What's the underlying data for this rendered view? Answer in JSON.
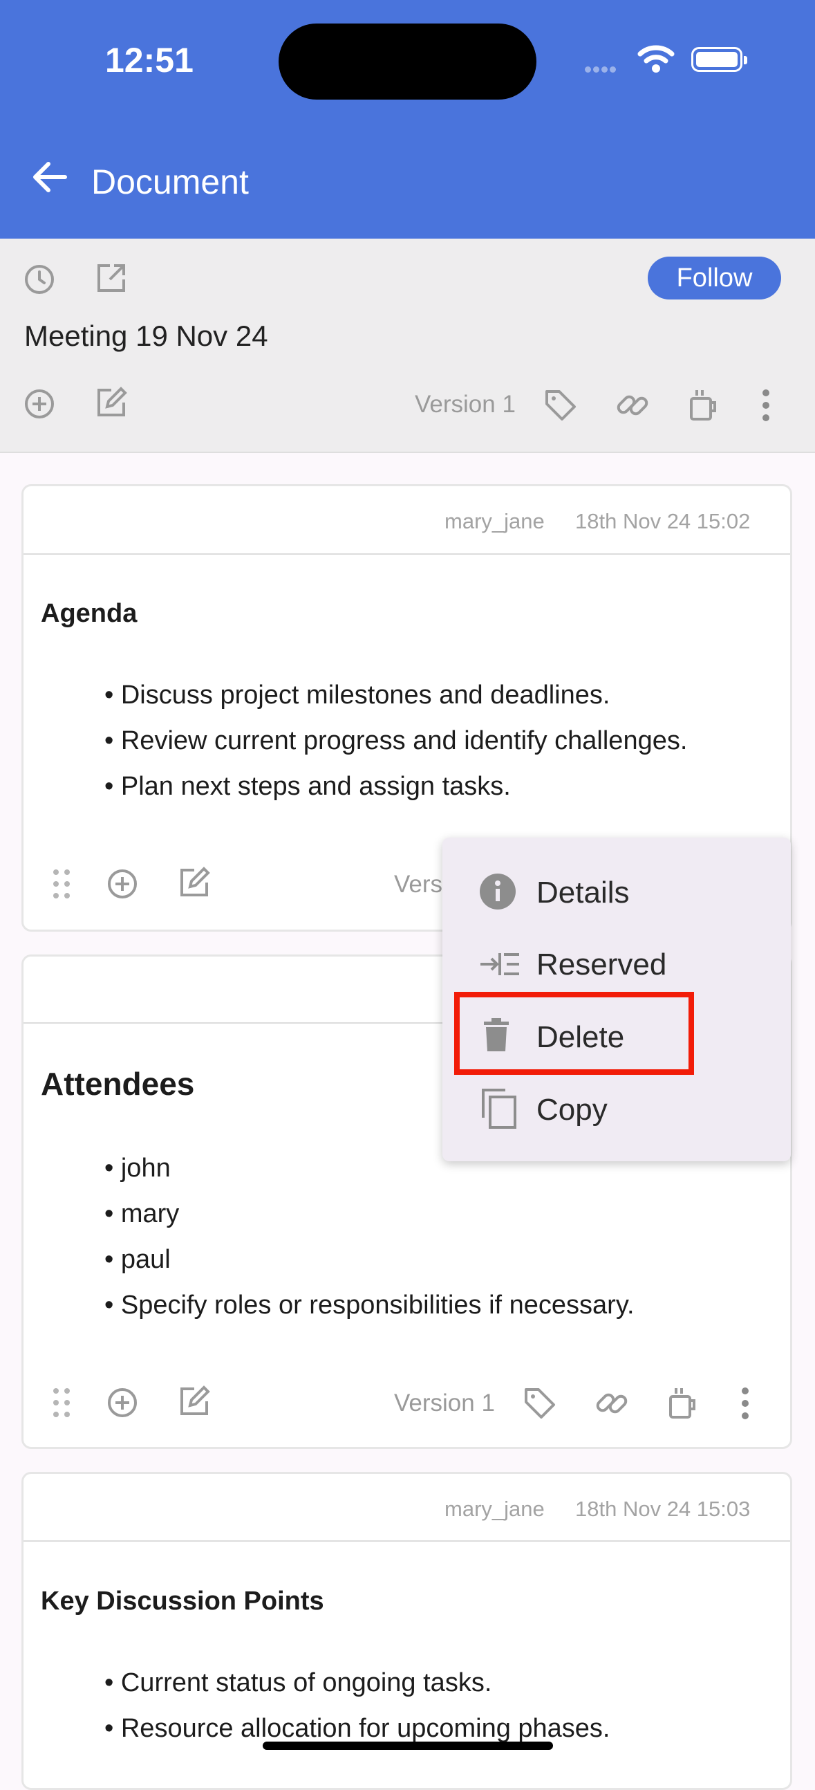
{
  "status_bar": {
    "time": "12:51"
  },
  "app_bar": {
    "title": "Document"
  },
  "doc_header": {
    "follow_label": "Follow",
    "doc_title": "Meeting 19 Nov 24",
    "version": "Version 1"
  },
  "cards": [
    {
      "author": "mary_jane",
      "timestamp": "18th Nov 24 15:02",
      "heading": "Agenda",
      "bullets": [
        "• Discuss project milestones and deadlines.",
        "• Review current progress and identify challenges.",
        "• Plan next steps and assign tasks."
      ],
      "version": "Versi"
    },
    {
      "heading": "Attendees",
      "bullets": [
        "• john",
        "• mary",
        "• paul",
        "• Specify roles or responsibilities if necessary."
      ],
      "version": "Version 1"
    },
    {
      "author": "mary_jane",
      "timestamp": "18th Nov 24 15:03",
      "heading": "Key Discussion Points",
      "bullets": [
        "• Current status of ongoing tasks.",
        "• Resource allocation for upcoming phases."
      ]
    }
  ],
  "context_menu": {
    "items": [
      {
        "label": "Details",
        "icon": "info-icon"
      },
      {
        "label": "Reserved",
        "icon": "indent-icon"
      },
      {
        "label": "Delete",
        "icon": "trash-icon"
      },
      {
        "label": "Copy",
        "icon": "copy-icon"
      }
    ],
    "highlighted": "Delete"
  },
  "colors": {
    "accent": "#4a74dc",
    "highlight": "#f21c08",
    "icon_gray": "#9a9a9a"
  }
}
